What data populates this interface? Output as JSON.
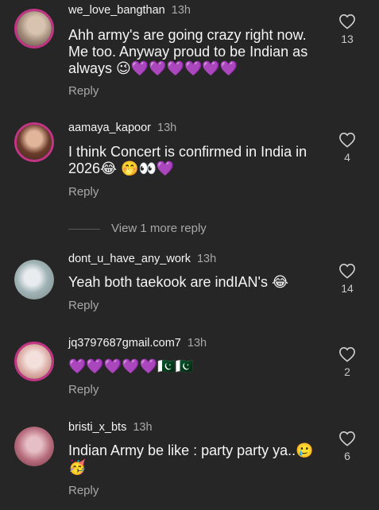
{
  "comments": [
    {
      "user": "we_love_bangthan",
      "time": "13h",
      "text": "Ahh army's are going crazy right now. Me too. Anyway proud to be Indian as always 😉💜💜💜💜💜💜",
      "reply": "Reply",
      "likes": "13"
    },
    {
      "user": "aamaya_kapoor",
      "time": "13h",
      "text": "I think Concert is confirmed in India in 2026😂 🤭👀💜",
      "reply": "Reply",
      "likes": "4"
    },
    {
      "user": "dont_u_have_any_work",
      "time": "13h",
      "text": "Yeah both taekook are indIAN's 😂",
      "reply": "Reply",
      "likes": "14"
    },
    {
      "user": "jq3797687gmail.com7",
      "time": "13h",
      "text": "💜💜💜💜💜🇵🇰🇵🇰",
      "reply": "Reply",
      "likes": "2"
    },
    {
      "user": "bristi_x_bts",
      "time": "13h",
      "text": "Indian Army be like : party party ya..🥲🥳",
      "reply": "Reply",
      "likes": "6"
    }
  ],
  "view_more_replies": "View 1 more reply",
  "colors": {
    "background": "#262626",
    "ring": "#c13584",
    "muted": "#a8a8a8"
  },
  "icons": {
    "like": "heart-outline-icon"
  }
}
